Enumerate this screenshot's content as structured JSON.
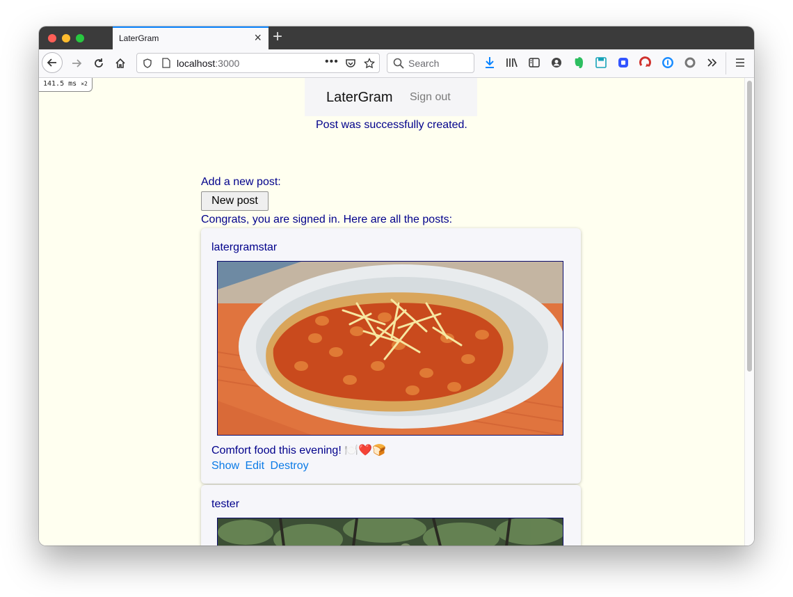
{
  "browser": {
    "tab_title": "LaterGram",
    "url_host": "localhost",
    "url_port": ":3000",
    "search_placeholder": "Search",
    "timing_label": "141.5 ms",
    "timing_multiplier": "×2"
  },
  "app": {
    "brand": "LaterGram",
    "sign_out": "Sign out",
    "notice": "Post was successfully created.",
    "add_label": "Add a new post:",
    "new_post_button": "New post",
    "congrats": "Congrats, you are signed in. Here are all the posts:"
  },
  "posts": [
    {
      "user": "latergramstar",
      "caption": "Comfort food this evening! 🍽️❤️🍞",
      "links": [
        "Show",
        "Edit",
        "Destroy"
      ]
    },
    {
      "user": "tester"
    }
  ],
  "colors": {
    "page_background": "#fffff0",
    "text_dark_blue": "#00008b",
    "link_blue": "#0a7ae6",
    "tab_accent": "#0a84ff"
  }
}
